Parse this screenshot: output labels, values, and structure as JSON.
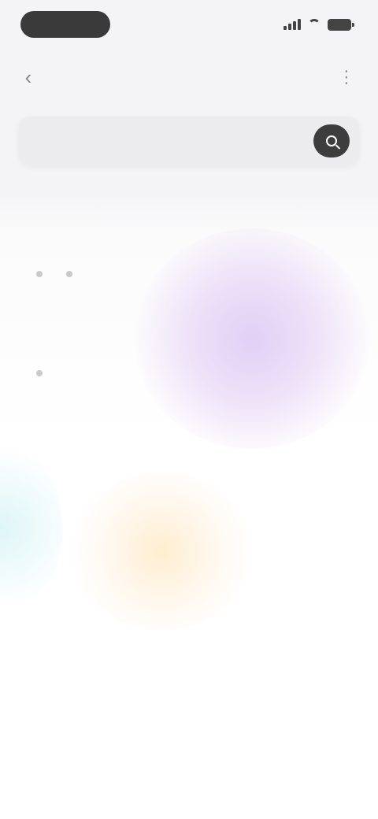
{
  "status_bar": {
    "time": ""
  },
  "nav": {
    "title": ""
  },
  "search": {
    "placeholder": ""
  },
  "section": {
    "title": ""
  },
  "groups": [
    {
      "title": "",
      "chips": [
        "",
        ""
      ],
      "note": ""
    },
    {
      "title": "",
      "chips": [
        ""
      ]
    }
  ],
  "icons": {
    "back": "chevron-left-icon",
    "more": "more-icon",
    "search": "search-icon"
  },
  "colors": {
    "status_pill": "#3a3a3a",
    "search_bg": "#ececef",
    "search_button": "#3d3d3d",
    "accent_purple": "#e0cdf5",
    "accent_yellow": "#ffecd0"
  }
}
